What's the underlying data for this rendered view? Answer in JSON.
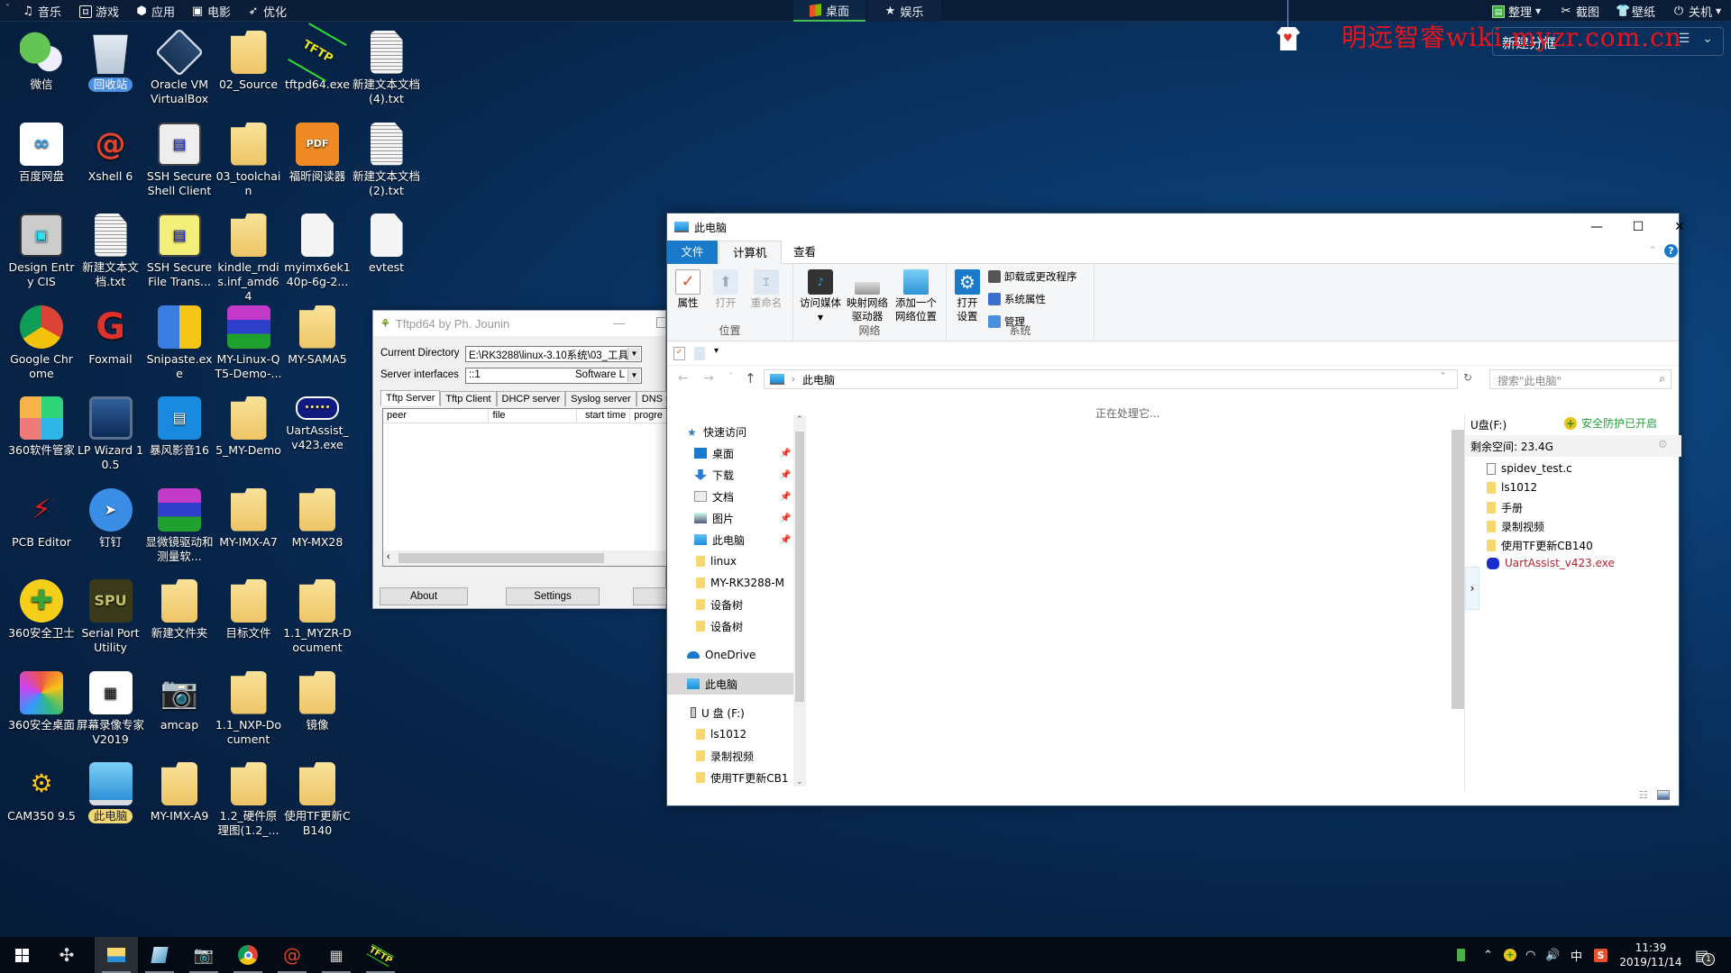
{
  "topbar": {
    "menu_items": [
      {
        "label": "音乐",
        "icon": "music-icon"
      },
      {
        "label": "游戏",
        "icon": "gamepad-icon"
      },
      {
        "label": "应用",
        "icon": "apps-icon"
      },
      {
        "label": "电影",
        "icon": "film-icon"
      },
      {
        "label": "优化",
        "icon": "rocket-icon"
      }
    ],
    "tabs": [
      {
        "label": "桌面",
        "active": true
      },
      {
        "label": "娱乐",
        "active": false
      }
    ],
    "right_items": [
      {
        "label": "整理",
        "icon": "organize-icon"
      },
      {
        "label": "截图",
        "icon": "screenshot-icon"
      },
      {
        "label": "壁纸",
        "icon": "wallpaper-icon"
      },
      {
        "label": "关机",
        "icon": "power-icon"
      }
    ]
  },
  "watermark": "明远智睿wiki.myzr.com.cn",
  "fence": {
    "title": "新建分框"
  },
  "desktop_icons": [
    {
      "label": "微信",
      "col": 0,
      "row": 0,
      "kind": "wechat"
    },
    {
      "label": "百度网盘",
      "col": 0,
      "row": 1,
      "kind": "baidu"
    },
    {
      "label": "Design Entry CIS",
      "col": 0,
      "row": 2,
      "kind": "cis"
    },
    {
      "label": "Google Chrome",
      "col": 0,
      "row": 3,
      "kind": "chrome"
    },
    {
      "label": "360软件管家",
      "col": 0,
      "row": 4,
      "kind": "soft360"
    },
    {
      "label": "PCB Editor",
      "col": 0,
      "row": 5,
      "kind": "pcb"
    },
    {
      "label": "360安全卫士",
      "col": 0,
      "row": 6,
      "kind": "safe360"
    },
    {
      "label": "360安全桌面",
      "col": 0,
      "row": 7,
      "kind": "desk360"
    },
    {
      "label": "CAM350 9.5",
      "col": 0,
      "row": 8,
      "kind": "cam350"
    },
    {
      "label": "回收站",
      "col": 1,
      "row": 0,
      "kind": "recycle",
      "selected": true
    },
    {
      "label": "Xshell 6",
      "col": 1,
      "row": 1,
      "kind": "xshell"
    },
    {
      "label": "新建文本文档.txt",
      "col": 1,
      "row": 2,
      "kind": "doc"
    },
    {
      "label": "Foxmail",
      "col": 1,
      "row": 3,
      "kind": "foxmail"
    },
    {
      "label": "LP Wizard 10.5",
      "col": 1,
      "row": 4,
      "kind": "lpwizard"
    },
    {
      "label": "钉钉",
      "col": 1,
      "row": 5,
      "kind": "dingtalk"
    },
    {
      "label": "Serial Port Utility",
      "col": 1,
      "row": 6,
      "kind": "spu"
    },
    {
      "label": "屏幕录像专家V2019",
      "col": 1,
      "row": 7,
      "kind": "recorder"
    },
    {
      "label": "此电脑",
      "col": 1,
      "row": 8,
      "kind": "pc",
      "selected": true
    },
    {
      "label": "Oracle VM VirtualBox",
      "col": 2,
      "row": 0,
      "kind": "vbox"
    },
    {
      "label": "SSH Secure Shell Client",
      "col": 2,
      "row": 1,
      "kind": "ssh"
    },
    {
      "label": "SSH Secure File Trans...",
      "col": 2,
      "row": 2,
      "kind": "sshftp"
    },
    {
      "label": "Snipaste.exe",
      "col": 2,
      "row": 3,
      "kind": "snipaste"
    },
    {
      "label": "暴风影音16",
      "col": 2,
      "row": 4,
      "kind": "baofeng"
    },
    {
      "label": "显微镜驱动和测量软...",
      "col": 2,
      "row": 5,
      "kind": "rar"
    },
    {
      "label": "新建文件夹",
      "col": 2,
      "row": 6,
      "kind": "folder"
    },
    {
      "label": "amcap",
      "col": 2,
      "row": 7,
      "kind": "camera"
    },
    {
      "label": "MY-IMX-A9",
      "col": 2,
      "row": 8,
      "kind": "folder"
    },
    {
      "label": "02_Source",
      "col": 3,
      "row": 0,
      "kind": "folder"
    },
    {
      "label": "03_toolchain",
      "col": 3,
      "row": 1,
      "kind": "folder"
    },
    {
      "label": "kindle_rndis.inf_amd64",
      "col": 3,
      "row": 2,
      "kind": "folder"
    },
    {
      "label": "MY-Linux-QT5-Demo-...",
      "col": 3,
      "row": 3,
      "kind": "rar"
    },
    {
      "label": "5_MY-Demo",
      "col": 3,
      "row": 4,
      "kind": "folder"
    },
    {
      "label": "MY-IMX-A7",
      "col": 3,
      "row": 5,
      "kind": "folder"
    },
    {
      "label": "目标文件",
      "col": 3,
      "row": 6,
      "kind": "folder"
    },
    {
      "label": "1.1_NXP-Document",
      "col": 3,
      "row": 7,
      "kind": "folder"
    },
    {
      "label": "1.2_硬件原理图(1.2_...",
      "col": 3,
      "row": 8,
      "kind": "folder"
    },
    {
      "label": "tftpd64.exe",
      "col": 4,
      "row": 0,
      "kind": "tftp"
    },
    {
      "label": "福昕阅读器",
      "col": 4,
      "row": 1,
      "kind": "foxit"
    },
    {
      "label": "myimx6ek140p-6g-2...",
      "col": 4,
      "row": 2,
      "kind": "blank"
    },
    {
      "label": "MY-SAMA5",
      "col": 4,
      "row": 3,
      "kind": "folder"
    },
    {
      "label": "UartAssist_v423.exe",
      "col": 4,
      "row": 4,
      "kind": "uart"
    },
    {
      "label": "MY-MX28",
      "col": 4,
      "row": 5,
      "kind": "folder"
    },
    {
      "label": "1.1_MYZR-Document",
      "col": 4,
      "row": 6,
      "kind": "folder"
    },
    {
      "label": "镜像",
      "col": 4,
      "row": 7,
      "kind": "folder"
    },
    {
      "label": "使用TF更新CB140",
      "col": 4,
      "row": 8,
      "kind": "folder"
    },
    {
      "label": "新建文本文档 (4).txt",
      "col": 5,
      "row": 0,
      "kind": "doc"
    },
    {
      "label": "新建文本文档 (2).txt",
      "col": 5,
      "row": 1,
      "kind": "doc"
    },
    {
      "label": "evtest",
      "col": 5,
      "row": 2,
      "kind": "blank"
    }
  ],
  "tftpd": {
    "title": "Tftpd64 by Ph. Jounin",
    "current_directory_label": "Current Directory",
    "current_directory_value": "E:\\RK3288\\linux-3.10系统\\03_工具",
    "server_interfaces_label": "Server interfaces",
    "server_interfaces_value": "::1",
    "server_interfaces_desc": "Software L",
    "tabs": [
      "Tftp Server",
      "Tftp Client",
      "DHCP server",
      "Syslog server",
      "DNS se"
    ],
    "columns": [
      "peer",
      "file",
      "start time",
      "progre"
    ],
    "buttons": {
      "about": "About",
      "settings": "Settings"
    }
  },
  "explorer": {
    "title": "此电脑",
    "ribbon_tabs": {
      "file": "文件",
      "computer": "计算机",
      "view": "查看"
    },
    "groups": {
      "location": {
        "label": "位置",
        "buttons": [
          "属性",
          "打开",
          "重命名"
        ]
      },
      "network": {
        "label": "网络",
        "buttons": [
          "访问媒体",
          "映射网络驱动器",
          "添加一个网络位置"
        ]
      },
      "system": {
        "label": "系统",
        "open_settings": "打开设置",
        "small": [
          "卸载或更改程序",
          "系统属性",
          "管理"
        ]
      }
    },
    "address": "此电脑",
    "search_placeholder": "搜索\"此电脑\"",
    "status_message": "正在处理它...",
    "nav": {
      "quick_access": "快速访问",
      "pinned": [
        "桌面",
        "下载",
        "文档",
        "图片",
        "此电脑"
      ],
      "recent": [
        "linux",
        "MY-RK3288-M",
        "设备树",
        "设备树"
      ],
      "onedrive": "OneDrive",
      "this_pc": "此电脑",
      "usb": "U 盘 (F:)",
      "usb_children": [
        "ls1012",
        "录制视频",
        "使用TF更新CB1"
      ]
    },
    "detail": {
      "drive": "U盘(F:)",
      "protection": "安全防护已开启",
      "free_space": "剩余空间: 23.4G",
      "files": [
        {
          "name": "spidev_test.c",
          "type": "file"
        },
        {
          "name": "ls1012",
          "type": "folder"
        },
        {
          "name": "手册",
          "type": "folder"
        },
        {
          "name": "录制视频",
          "type": "folder"
        },
        {
          "name": "使用TF更新CB140",
          "type": "folder"
        },
        {
          "name": "UartAssist_v423.exe",
          "type": "exe"
        }
      ]
    }
  },
  "taskbar": {
    "apps": [
      "start",
      "fan",
      "file-explorer",
      "notepad",
      "camera",
      "chrome",
      "xshell",
      "recorder",
      "tftpd"
    ],
    "ime": "中",
    "time": "11:39",
    "date": "2019/11/14",
    "notification_count": "1"
  }
}
